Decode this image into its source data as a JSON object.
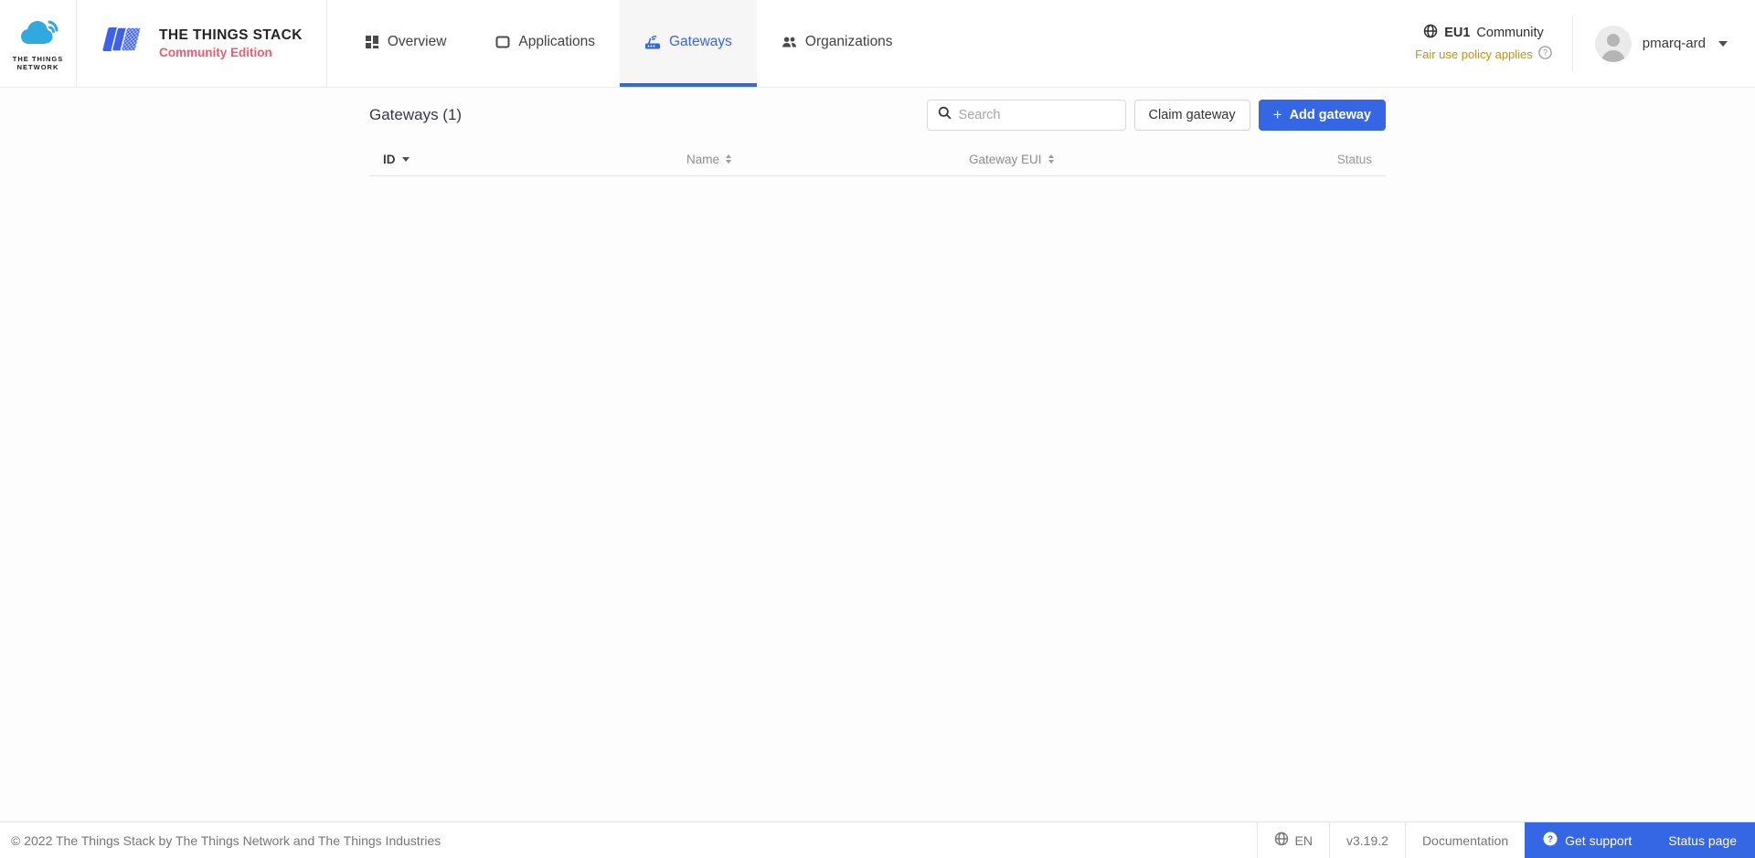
{
  "colors": {
    "accent": "#3567e4",
    "community_red": "#f25a6e",
    "ttn_blue": "#2fa9e0",
    "fair_use_orange": "#c3920e",
    "text_dark": "#373a40",
    "text_gray": "#8d8d8d"
  },
  "header": {
    "ttn_logo": {
      "line1": "THE THINGS",
      "line2": "NETWORK",
      "icon": "ttn-cloud-logo"
    },
    "tts_logo": {
      "title": "THE THINGS STACK",
      "subtitle": "Community Edition",
      "icon": "tts-stack-logo"
    },
    "nav": [
      {
        "label": "Overview",
        "icon": "overview-grid-icon",
        "active": false
      },
      {
        "label": "Applications",
        "icon": "application-window-icon",
        "active": false
      },
      {
        "label": "Gateways",
        "icon": "gateway-router-icon",
        "active": true
      },
      {
        "label": "Organizations",
        "icon": "organizations-people-icon",
        "active": false
      }
    ],
    "cluster": {
      "region": "EU1",
      "network": "Community",
      "fair_use": "Fair use policy applies",
      "globe_icon": "globe-icon",
      "help_icon": "question-circle-icon"
    },
    "user": {
      "name": "pmarq-ard",
      "avatar_icon": "person-silhouette",
      "caret_icon": "triangle-down"
    }
  },
  "main": {
    "title": "Gateways (1)",
    "search": {
      "placeholder": "Search",
      "icon": "magnifier-icon",
      "value": ""
    },
    "claim_button": "Claim gateway",
    "add_button": {
      "label": "Add gateway",
      "plus_glyph": "+"
    },
    "table": {
      "columns": [
        {
          "label": "ID",
          "sort": "desc"
        },
        {
          "label": "Name",
          "sort": "both"
        },
        {
          "label": "Gateway EUI",
          "sort": "both"
        },
        {
          "label": "Status",
          "sort": "none"
        }
      ],
      "rows": []
    }
  },
  "footer": {
    "copyright": "© 2022 The Things Stack by The Things Network and The Things Industries",
    "language": "EN",
    "version": "v3.19.2",
    "documentation": "Documentation",
    "get_support": "Get support",
    "status_page": "Status page"
  }
}
